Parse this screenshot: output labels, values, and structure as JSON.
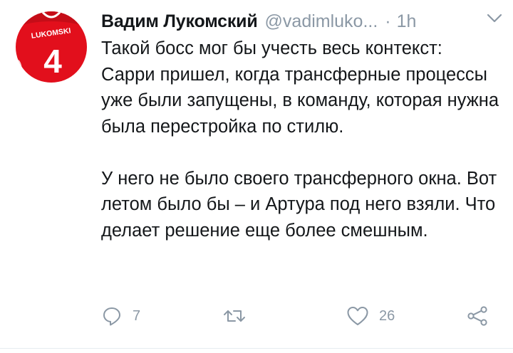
{
  "tweet": {
    "author_name": "Вадим Лукомский",
    "author_handle": "@vadimluko...",
    "separator": "·",
    "timestamp": "1h",
    "avatar": {
      "jersey_name": "LUKOMSKI",
      "jersey_number": "4",
      "jersey_color": "#e20f1c"
    },
    "text_paragraphs": [
      "Такой босс мог бы учесть весь контекст: Сарри пришел, когда трансферные процессы уже были запущены, в команду, которая нужна была перестройка по стилю.",
      "У него не было своего трансферного окна. Вот летом было бы – и Артура под него взяли. Что делает решение еще более смешным."
    ],
    "actions": {
      "reply_icon": "reply-icon",
      "reply_count": "7",
      "retweet_icon": "retweet-icon",
      "retweet_count": "",
      "like_icon": "heart-icon",
      "like_count": "26",
      "share_icon": "share-icon"
    },
    "menu_icon": "chevron-down-icon"
  },
  "colors": {
    "text": "#14171a",
    "muted": "#8b98a5",
    "divider": "#e6ecf0"
  }
}
